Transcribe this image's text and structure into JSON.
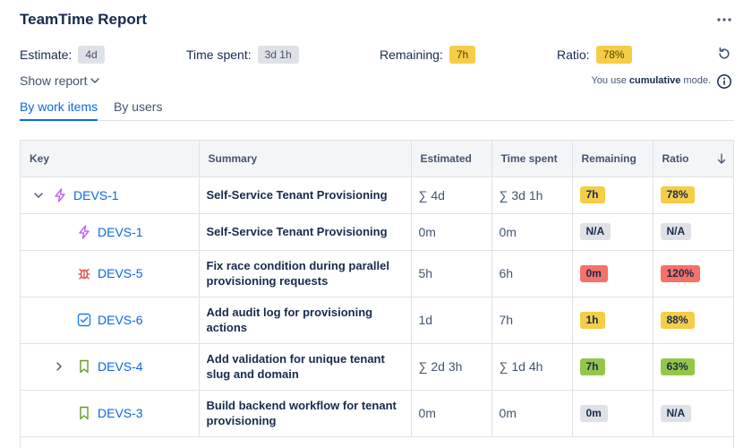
{
  "header": {
    "title": "TeamTime Report",
    "more_icon": "more-horizontal-icon"
  },
  "stats": {
    "estimate": {
      "label": "Estimate:",
      "value": "4d"
    },
    "time_spent": {
      "label": "Time spent:",
      "value": "3d 1h"
    },
    "remaining": {
      "label": "Remaining:",
      "value": "7h"
    },
    "ratio": {
      "label": "Ratio:",
      "value": "78%"
    }
  },
  "controls": {
    "show_report": "Show report",
    "mode_note_prefix": "You use",
    "mode_note_mode": "cumulative",
    "mode_note_suffix": "mode."
  },
  "tabs": [
    {
      "label": "By work items",
      "active": true
    },
    {
      "label": "By users",
      "active": false
    }
  ],
  "colors": {
    "accent": "#0c66e4",
    "yellow": "#f5cd47",
    "green": "#94c748",
    "red": "#f87168",
    "gray": "#dfe1e6",
    "epic": "#bf63f3",
    "bug": "#e2483d",
    "task": "#1d7afc",
    "story": "#6a9a23"
  },
  "table": {
    "columns": [
      "Key",
      "Summary",
      "Estimated",
      "Time spent",
      "Remaining",
      "Ratio"
    ],
    "rows": [
      {
        "key": "DEVS-1",
        "icon": "epic-icon",
        "summary": "Self-Service Tenant Provisioning",
        "estimated": "∑ 4d",
        "time_spent": "∑ 3d 1h",
        "remaining": "7h",
        "remaining_color": "yellow",
        "ratio": "78%",
        "ratio_color": "yellow"
      },
      {
        "key": "DEVS-1",
        "icon": "epic-icon",
        "summary": "Self-Service Tenant Provisioning",
        "estimated": "0m",
        "time_spent": "0m",
        "remaining": "N/A",
        "remaining_color": "gray",
        "ratio": "N/A",
        "ratio_color": "gray"
      },
      {
        "key": "DEVS-5",
        "icon": "bug-icon",
        "summary": "Fix race condition during parallel provisioning requests",
        "estimated": "5h",
        "time_spent": "6h",
        "remaining": "0m",
        "remaining_color": "red",
        "ratio": "120%",
        "ratio_color": "red"
      },
      {
        "key": "DEVS-6",
        "icon": "task-icon",
        "summary": "Add audit log for provisioning actions",
        "estimated": "1d",
        "time_spent": "7h",
        "remaining": "1h",
        "remaining_color": "yellow",
        "ratio": "88%",
        "ratio_color": "yellow"
      },
      {
        "key": "DEVS-4",
        "icon": "story-icon",
        "summary": "Add validation for unique tenant slug and domain",
        "estimated": "∑ 2d 3h",
        "time_spent": "∑ 1d 4h",
        "remaining": "7h",
        "remaining_color": "green",
        "ratio": "63%",
        "ratio_color": "green"
      },
      {
        "key": "DEVS-3",
        "icon": "story-icon",
        "summary": "Build backend workflow for tenant provisioning",
        "estimated": "0m",
        "time_spent": "0m",
        "remaining": "0m",
        "remaining_color": "gray",
        "ratio": "N/A",
        "ratio_color": "gray"
      }
    ]
  }
}
